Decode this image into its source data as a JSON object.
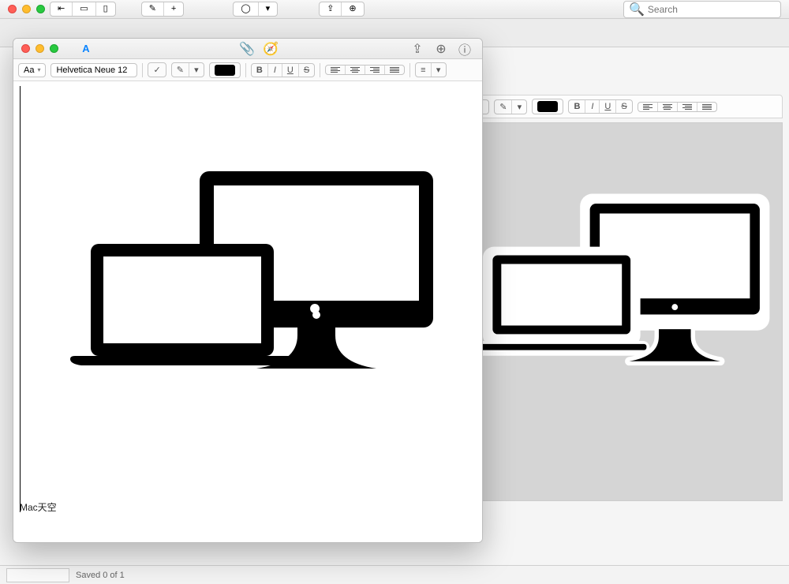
{
  "bg": {
    "search_placeholder": "Search",
    "status": "Saved 0 of 1"
  },
  "fg": {
    "font": "Helvetica Neue 12",
    "font_selector_label": "Aa",
    "credit": "Mac天空"
  },
  "icons": {
    "attachment": "📎",
    "compass": "🧭",
    "share": "⇪",
    "add_user": "⊕",
    "info": "ⓘ",
    "compose": "✎",
    "plus": "+",
    "collapse_left": "⇤",
    "layout1": "▭",
    "layout2": "▯",
    "circle": "◯",
    "chev_down": "▾",
    "check": "✓",
    "pencil": "✎",
    "bold": "B",
    "italic": "I",
    "underline": "U",
    "strike": "S",
    "list": "≡"
  }
}
